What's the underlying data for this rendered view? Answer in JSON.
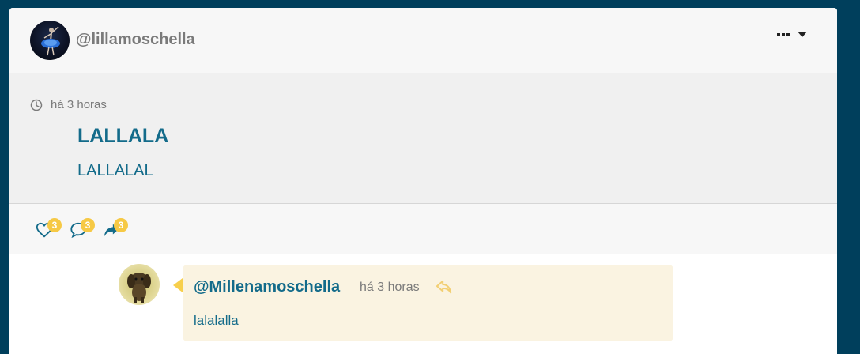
{
  "post": {
    "username": "@lillamoschella",
    "time": "há 3 horas",
    "title": "LALLALA",
    "text": "LALLALAL",
    "menu_icon": "more-dots-icon",
    "likes": "3",
    "comments": "3",
    "shares": "3"
  },
  "comment": {
    "author": "@Millenamoschella",
    "time": "há 3 horas",
    "text": "lalalalla",
    "reply_icon": "reply-icon"
  },
  "colors": {
    "background": "#003f5c",
    "accent": "#136b8a",
    "badge": "#f6c945",
    "bubble": "#faf3e1"
  }
}
